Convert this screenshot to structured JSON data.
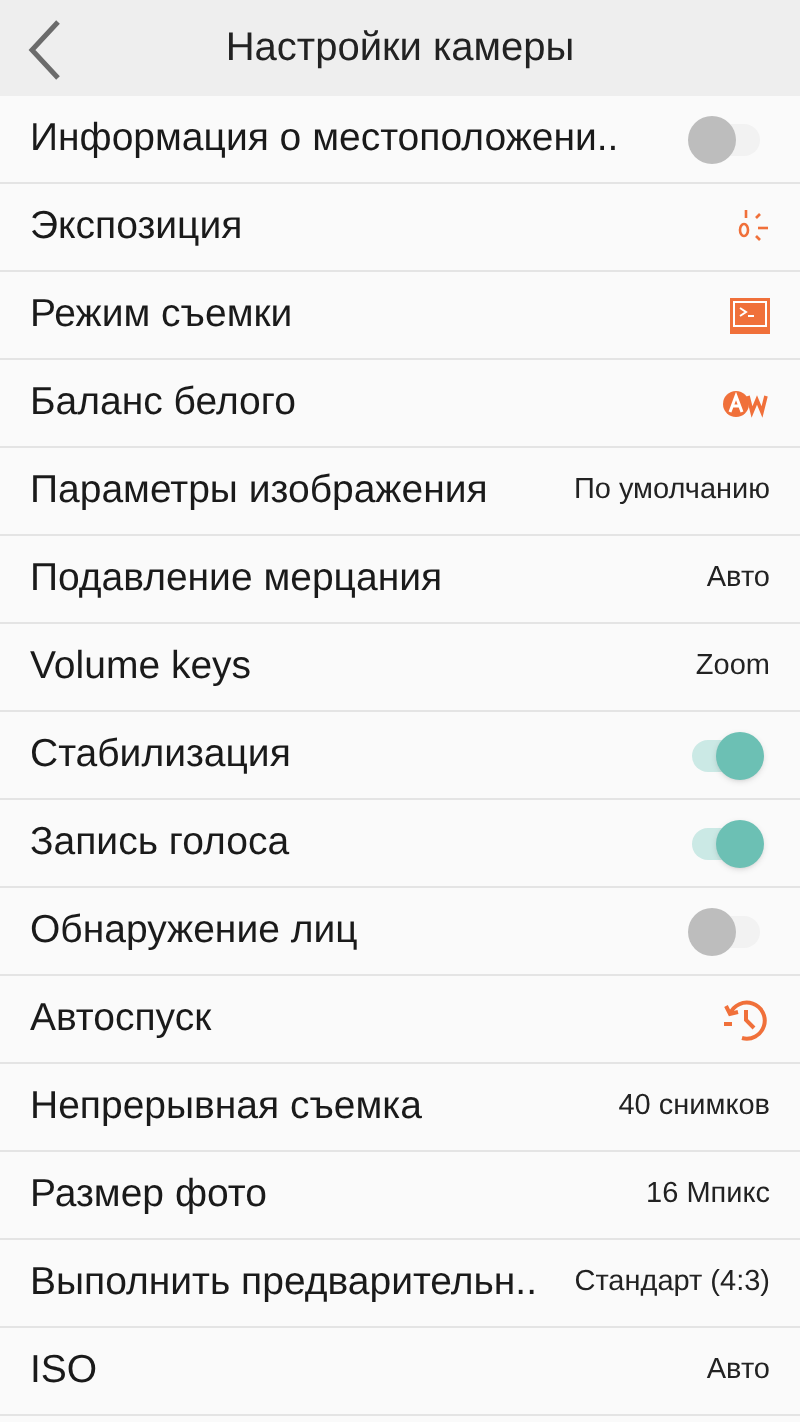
{
  "header": {
    "title": "Настройки камеры"
  },
  "rows": [
    {
      "label": "Информация о местоположени..",
      "kind": "toggle",
      "on": false
    },
    {
      "label": "Экспозиция",
      "kind": "exposure"
    },
    {
      "label": "Режим съемки",
      "kind": "shooting-mode"
    },
    {
      "label": "Баланс белого",
      "kind": "white-balance"
    },
    {
      "label": "Параметры изображения",
      "kind": "value",
      "value": "По умолчанию"
    },
    {
      "label": "Подавление мерцания",
      "kind": "value",
      "value": "Авто"
    },
    {
      "label": "Volume keys",
      "kind": "value",
      "value": "Zoom"
    },
    {
      "label": "Стабилизация",
      "kind": "toggle",
      "on": true
    },
    {
      "label": "Запись голоса",
      "kind": "toggle",
      "on": true
    },
    {
      "label": "Обнаружение лиц",
      "kind": "toggle",
      "on": false
    },
    {
      "label": "Автоспуск",
      "kind": "timer"
    },
    {
      "label": "Непрерывная съемка",
      "kind": "value",
      "value": "40 снимков"
    },
    {
      "label": "Размер фото",
      "kind": "value",
      "value": "16 Мпикс"
    },
    {
      "label": "Выполнить предварительн..",
      "kind": "value",
      "value": "Стандарт (4:3)"
    },
    {
      "label": "ISO",
      "kind": "value",
      "value": "Авто"
    }
  ]
}
